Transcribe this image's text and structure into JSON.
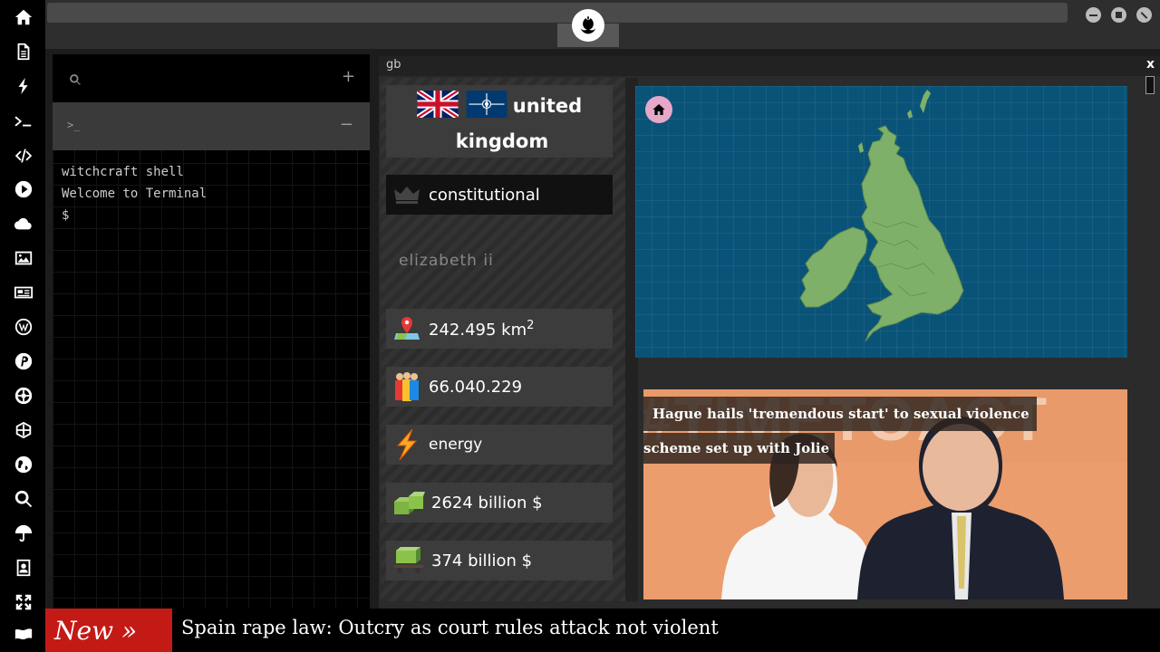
{
  "sidebar": {
    "icons": [
      "home-icon",
      "document-icon",
      "lightning-icon",
      "terminal-icon",
      "code-icon",
      "play-icon",
      "cloud-icon",
      "image-icon",
      "newspaper-icon",
      "wordpress-icon",
      "pinterest-icon",
      "empire-icon",
      "globe-grid-icon",
      "globe-icon",
      "search-icon",
      "umbrella-icon",
      "contacts-icon",
      "fullscreen-icon",
      "flag-icon"
    ]
  },
  "window": {
    "logo": "rebel-alliance-icon"
  },
  "terminal": {
    "search_placeholder": "",
    "add_label": "+",
    "prompt_symbol": ">_",
    "collapse_label": "−",
    "lines": [
      "witchcraft shell",
      "Welcome to Terminal",
      "$"
    ]
  },
  "panel": {
    "code": "gb",
    "close_label": "x",
    "country_name_1": "united",
    "country_name_2": "kingdom",
    "government": "constitutional",
    "leader": "elizabeth ii",
    "area": "242.495 km",
    "area_sup": "2",
    "population": "66.040.229",
    "resource": "energy",
    "gdp": "2624 billion $",
    "budget": "374 billion $"
  },
  "news": {
    "headline_line1": "Hague hails 'tremendous start' to sexual violence",
    "headline_line2": "scheme set up with Jolie",
    "image_banner": "#TIMETOACT"
  },
  "ticker": {
    "tag": "New »",
    "text": "Spain rape law: Outcry as court rules attack not violent"
  },
  "colors": {
    "accent": "#c41a16",
    "map_sea": "#0a5378",
    "land": "#7fb069"
  }
}
